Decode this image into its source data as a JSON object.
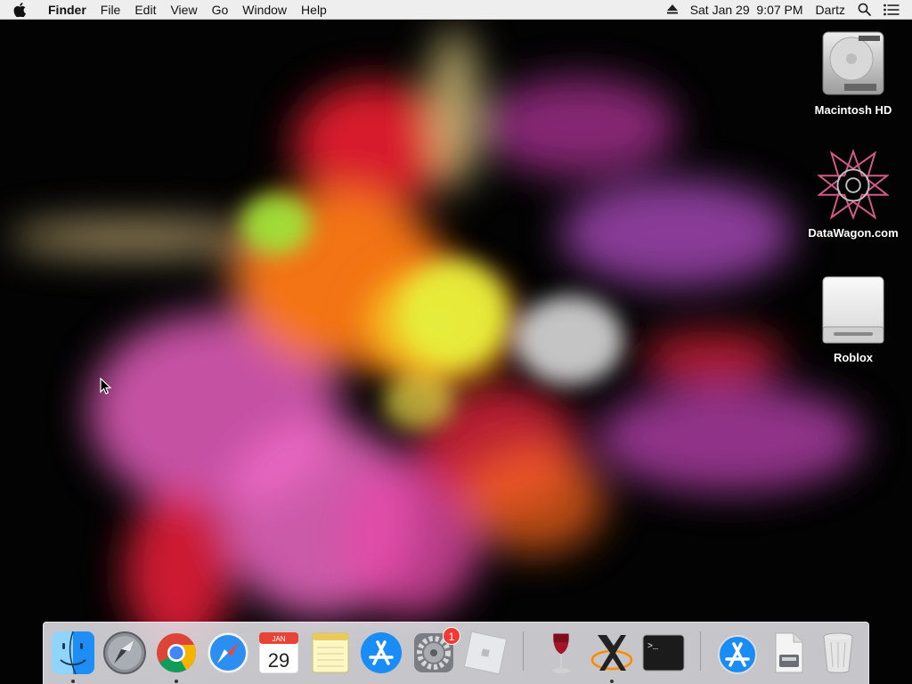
{
  "menubar": {
    "app_name": "Finder",
    "items": [
      "File",
      "Edit",
      "View",
      "Go",
      "Window",
      "Help"
    ],
    "status": {
      "date_time": "Sat Jan 29  9:07 PM",
      "user": "Dartz"
    }
  },
  "desktop": {
    "icons": [
      {
        "label": "Macintosh HD"
      },
      {
        "label": "DataWagon.com"
      },
      {
        "label": "Roblox"
      }
    ]
  },
  "dock": {
    "calendar_month": "JAN",
    "calendar_day": "29",
    "system_prefs_badge": "1",
    "terminal_prompt": ">_"
  },
  "colors": {
    "menubar_bg": "#f6f6f6",
    "dock_bg": "#e1e1e6",
    "badge_red": "#f03a33",
    "finder_blue": "#1e8ef5"
  }
}
